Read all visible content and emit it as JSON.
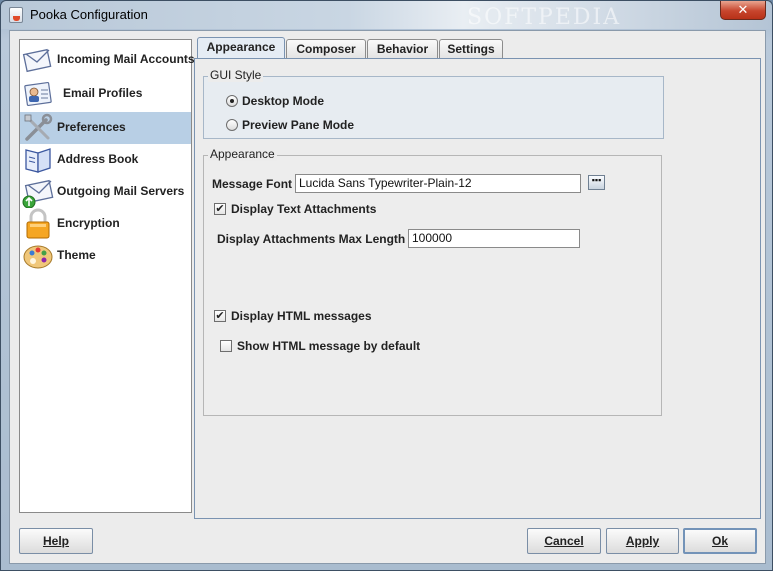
{
  "window": {
    "title": "Pooka Configuration",
    "watermark": "SOFTPEDIA",
    "close_label": "✕"
  },
  "sidebar": {
    "items": [
      {
        "label": "Incoming Mail Accounts",
        "icon": "incoming-mail-icon",
        "selected": false
      },
      {
        "label": "Email Profiles",
        "icon": "email-profiles-icon",
        "selected": false
      },
      {
        "label": "Preferences",
        "icon": "preferences-icon",
        "selected": true
      },
      {
        "label": "Address Book",
        "icon": "address-book-icon",
        "selected": false
      },
      {
        "label": "Outgoing Mail Servers",
        "icon": "outgoing-mail-icon",
        "selected": false
      },
      {
        "label": "Encryption",
        "icon": "lock-icon",
        "selected": false
      },
      {
        "label": "Theme",
        "icon": "palette-icon",
        "selected": false
      }
    ]
  },
  "tabs": [
    {
      "label": "Appearance",
      "active": true
    },
    {
      "label": "Composer",
      "active": false
    },
    {
      "label": "Behavior",
      "active": false
    },
    {
      "label": "Settings",
      "active": false
    }
  ],
  "gui_style": {
    "title": "GUI Style",
    "options": [
      {
        "label": "Desktop Mode",
        "checked": true
      },
      {
        "label": "Preview Pane Mode",
        "checked": false
      }
    ]
  },
  "appearance": {
    "title": "Appearance",
    "message_font_label": "Message Font",
    "message_font_value": "Lucida Sans Typewriter-Plain-12",
    "font_button_label": "▪▪▪",
    "display_text_attachments": {
      "label": "Display Text Attachments",
      "checked": true
    },
    "max_length_label": "Display Attachments Max Length",
    "max_length_value": "100000",
    "display_html_messages": {
      "label": "Display HTML messages",
      "checked": true
    },
    "show_html_default": {
      "label": "Show HTML message by default",
      "checked": false
    }
  },
  "buttons": {
    "help": "Help",
    "cancel": "Cancel",
    "apply": "Apply",
    "ok": "Ok"
  },
  "colors": {
    "selection": "#b8cfe5",
    "title_close": "#c7452d"
  }
}
